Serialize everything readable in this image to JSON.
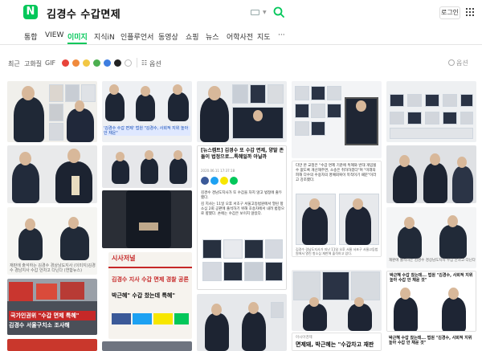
{
  "header": {
    "logo_letter": "N",
    "search_query": "김경수 수갑면제",
    "login_label": "로그인"
  },
  "tabs": [
    {
      "label": "통합"
    },
    {
      "label": "VIEW"
    },
    {
      "label": "이미지"
    },
    {
      "label": "지식iN"
    },
    {
      "label": "인플루언서"
    },
    {
      "label": "동영상"
    },
    {
      "label": "쇼핑"
    },
    {
      "label": "뉴스"
    },
    {
      "label": "어학사전"
    },
    {
      "label": "지도"
    },
    {
      "label": "···"
    }
  ],
  "options_label": "옵션",
  "filters": {
    "recent": "최근",
    "hires": "고화질",
    "gif": "GIF",
    "colors": [
      "#e8443a",
      "#f08a3c",
      "#f2c744",
      "#4caf50",
      "#3e7ee0",
      "#222222",
      "#ffffff"
    ],
    "options": "옵션"
  },
  "captions": {
    "news1_title": "[뉴스캠트] 김경수 또 수갑 면제, 양말 존들이 법정으로…특혜일까 아닐까",
    "news1_meta": "2020.06.11 17:37:18",
    "news1_body": "김경수 경남도지사가 또 수갑을 차지 않고 법정에 출두했다.",
    "news1_body2": "김 지사는 11일 오후 서초구 서울고등법원에서 열린 항소심 2회 공판에 출석하기 위해 호송차에서 내려 법정으로 향했다. 손에는 수갑은 보이지 않았다.",
    "col3_caption": "다만 본 교정은 \"수갑 면제 기준에 특혜와 반대 개입될 수 없도록 개선해주면, 소송은 취하하겠다\"며 \"미래의 피해 다수의 수용자의 명예회복이 목적이기 때문\"이라고 강조했다.",
    "col3_caption2": "김경수 경남도지사가 지난 11일 오후 서울 서초구 서울고등법원에서 열린 항소심 재판에 출석하고 있다.",
    "col4_caption": "박근혜 수갑 찼는데... 법원 \"김경수, 사회적 지위 높아 수갑 안 채운 것\"",
    "col4_caption2": "박근혜 수갑 찼는데... 법원 \"김경수, 사회적 지위 높아 수갑 안 채운 것\"",
    "col4_bottom": "면제돼, 박근혜는 \"수갑차고 재판",
    "col4_bottom_source": "아시아경제",
    "col1_caption": "재판에 출석하는 김경수 경상남도지사 (이미지)김경수 경남지사 수갑 안차고 다닌다 (연합뉴스)",
    "col1_banner1": "국가인권위 \"수갑 면제 특혜\"",
    "col1_banner2": "김경수 서울구치소 조사해",
    "col2_top_caption": "'김경수 수갑 면제' 법원 \"김경수, 사회적 지위 높아 안 채운\"",
    "col2_poster_title": "김경수 지사 수갑 면제 경찰 공론",
    "col2_poster_sub": "박근혜\" 수갑 찼는데 특혜\"",
    "col2_poster_brand": "시사저널",
    "col4_top_caption": "재판에 출석하는 김경수 경상남도지사 수갑 안차고 다닌다"
  }
}
